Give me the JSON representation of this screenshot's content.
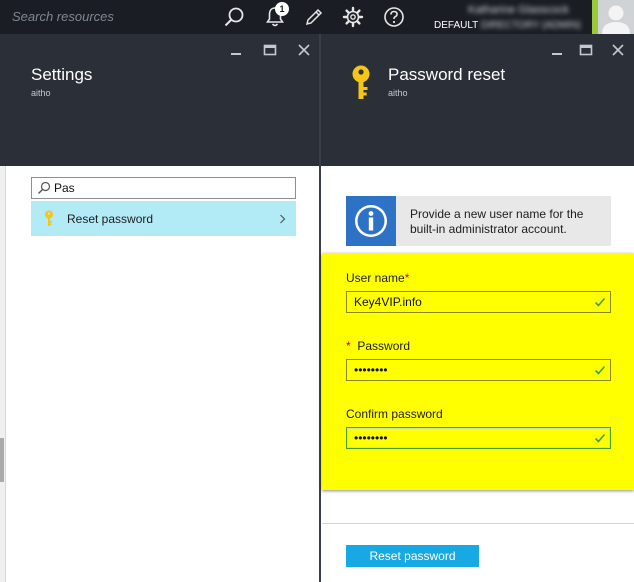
{
  "topbar": {
    "search_placeholder": "Search resources",
    "notification_count": "1",
    "account_name": "Katharine Glasscock",
    "account_directory_prefix": "DEFAULT",
    "account_directory_rest": " DIRECTORY (ADMIN)"
  },
  "settings_blade": {
    "title": "Settings",
    "subtitle": "aitho",
    "filter_value": "Pas",
    "results": [
      {
        "label": "Reset password",
        "icon": "key-icon"
      }
    ]
  },
  "password_blade": {
    "title": "Password reset",
    "subtitle": "aitho",
    "info_text": "Provide a new user name for the built-in administrator account.",
    "username_label": "User name",
    "username_value": "Key4VIP.info",
    "password_label": "Password",
    "password_value": "••••••••",
    "confirm_label": "Confirm password",
    "confirm_value": "••••••••",
    "required_marker": "*",
    "submit_label": "Reset password"
  },
  "colors": {
    "topbar_bg": "#1a1e24",
    "blade_header_bg": "#2b3038",
    "selection_bg": "#b2ebf6",
    "highlight_panel": "#ffff00",
    "primary_button": "#17a9e3",
    "info_icon_bg": "#2d72c4",
    "key_icon": "#f5c518",
    "valid_check": "#45a03c",
    "required_marker": "#cc0000"
  }
}
